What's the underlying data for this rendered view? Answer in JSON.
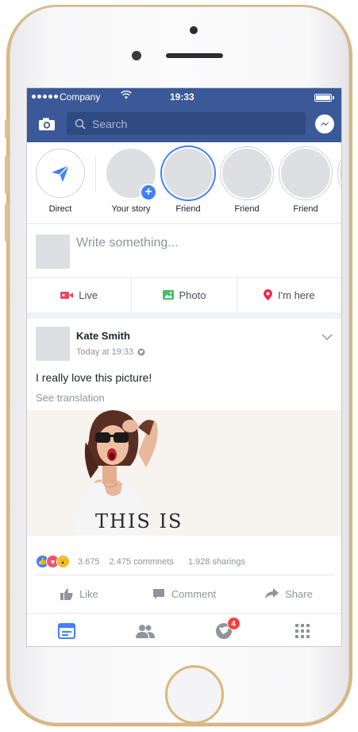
{
  "status_bar": {
    "carrier": "Company",
    "time": "19:33"
  },
  "header": {
    "search_placeholder": "Search"
  },
  "stories": [
    {
      "label": "Direct"
    },
    {
      "label": "Your story"
    },
    {
      "label": "Friend"
    },
    {
      "label": "Friend"
    },
    {
      "label": "Friend"
    }
  ],
  "composer": {
    "placeholder": "Write something..."
  },
  "composer_actions": {
    "live": "Live",
    "photo": "Photo",
    "checkin": "I'm here"
  },
  "post": {
    "author": "Kate Smith",
    "timestamp": "Today at 19:33",
    "text": "I really love this picture!",
    "see_translation": "See translation",
    "shirt_text": "THIS IS",
    "reactions_count": "3.675",
    "comments_count": "2.475 commnets",
    "shares_count": "1.928 sharings",
    "actions": {
      "like": "Like",
      "comment": "Comment",
      "share": "Share"
    }
  },
  "tabbar": {
    "notifications_badge": "4"
  },
  "colors": {
    "header_blue": "#3b5998",
    "accent_blue": "#4080ff",
    "badge_red": "#fa3e3e",
    "phone_gold": "#d9b77e"
  }
}
